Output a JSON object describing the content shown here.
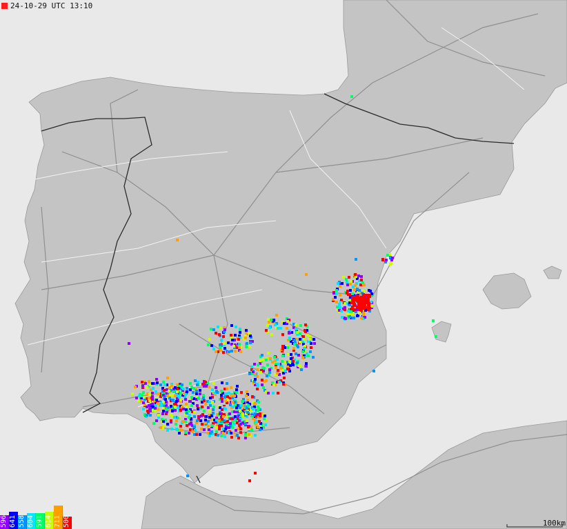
{
  "map": {
    "timestamp": "24-10-29 UTC 13:10",
    "scale_label": "100km",
    "colors": {
      "sea": "#e9e9e9",
      "land": "#c4c4c4",
      "roads": "#8f8f8f",
      "rivers": "#f3f3f3",
      "borders": "#2a2a2a"
    }
  },
  "legend": [
    {
      "label": "596",
      "color": "#8f00ff",
      "level": 0.45
    },
    {
      "label": "641",
      "color": "#0000ff",
      "level": 0.55
    },
    {
      "label": "558",
      "color": "#0096ff",
      "level": 0.45
    },
    {
      "label": "604",
      "color": "#00e6ff",
      "level": 0.5
    },
    {
      "label": "591",
      "color": "#00ff64",
      "level": 0.5
    },
    {
      "label": "614",
      "color": "#c8ff00",
      "level": 0.55
    },
    {
      "label": "711",
      "color": "#ffa000",
      "level": 0.75
    },
    {
      "label": "500",
      "color": "#ff0000",
      "level": 0.4
    }
  ]
}
